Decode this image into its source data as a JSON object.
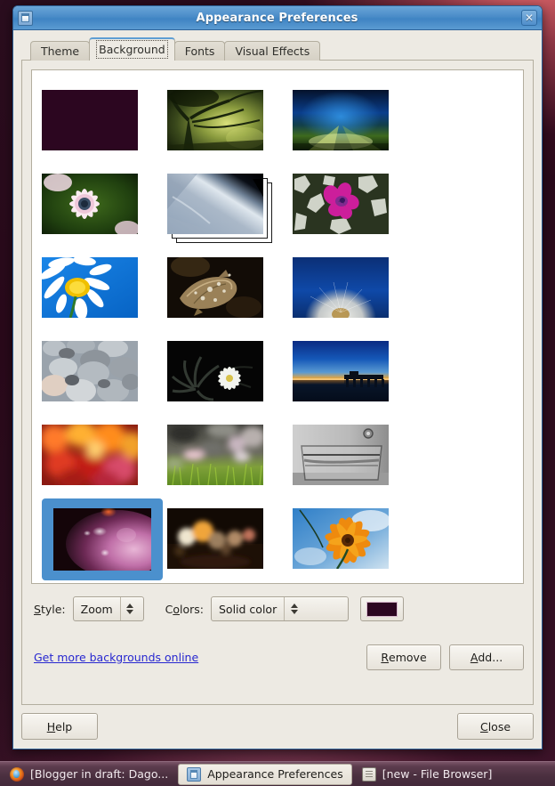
{
  "window": {
    "title": "Appearance Preferences",
    "icon": "appearance-window-icon",
    "close_icon": "close-icon",
    "titlebar_color": "#4a8cc8"
  },
  "tabs": [
    {
      "label": "Theme",
      "active": false
    },
    {
      "label": "Background",
      "active": true
    },
    {
      "label": "Fonts",
      "active": false
    },
    {
      "label": "Visual Effects",
      "active": false
    }
  ],
  "wallpapers": [
    {
      "name": "solid-plum",
      "type": "solid",
      "selected": false,
      "stacked": false
    },
    {
      "name": "backlit-tree",
      "type": "photo",
      "selected": false,
      "stacked": false
    },
    {
      "name": "blue-green-road-blur",
      "type": "photo",
      "selected": false,
      "stacked": false
    },
    {
      "name": "pink-white-daisy",
      "type": "photo",
      "selected": false,
      "stacked": false
    },
    {
      "name": "earth-from-orbit-slideshow",
      "type": "slideshow",
      "selected": false,
      "stacked": true
    },
    {
      "name": "magenta-flowers-silver-foliage",
      "type": "photo",
      "selected": false,
      "stacked": false
    },
    {
      "name": "white-daisy-blue-sky",
      "type": "photo",
      "selected": false,
      "stacked": false
    },
    {
      "name": "dry-leaf-dewdrops",
      "type": "photo",
      "selected": false,
      "stacked": false
    },
    {
      "name": "dandelion-seedhead-blue",
      "type": "photo",
      "selected": false,
      "stacked": false
    },
    {
      "name": "grey-pebbles",
      "type": "photo",
      "selected": false,
      "stacked": false
    },
    {
      "name": "white-flower-black-background",
      "type": "photo",
      "selected": false,
      "stacked": false
    },
    {
      "name": "pier-at-dusk",
      "type": "photo",
      "selected": false,
      "stacked": false
    },
    {
      "name": "red-orange-bokeh",
      "type": "photo",
      "selected": false,
      "stacked": false
    },
    {
      "name": "green-grass-bokeh",
      "type": "photo",
      "selected": false,
      "stacked": false
    },
    {
      "name": "greyscale-glass-water",
      "type": "photo",
      "selected": false,
      "stacked": false
    },
    {
      "name": "ubuntu-purple-warty",
      "type": "photo",
      "selected": true,
      "stacked": false
    },
    {
      "name": "amber-night-bokeh",
      "type": "photo",
      "selected": false,
      "stacked": false
    },
    {
      "name": "orange-cosmos-flower",
      "type": "photo",
      "selected": false,
      "stacked": false
    }
  ],
  "controls": {
    "style_label": "Style:",
    "style_label_mnemonic": "S",
    "style_value": "Zoom",
    "colors_label": "Colors:",
    "colors_label_mnemonic": "o",
    "colors_value": "Solid color",
    "color_swatch_hex": "#2c0620",
    "spinner_icon": "up-down-chevron-icon"
  },
  "links": {
    "more_backgrounds": "Get more backgrounds online"
  },
  "buttons": {
    "remove": "Remove",
    "remove_mnemonic": "R",
    "add": "Add...",
    "add_mnemonic": "A",
    "help": "Help",
    "help_mnemonic": "H",
    "close": "Close",
    "close_mnemonic": "C"
  },
  "taskbar": {
    "items": [
      {
        "label": "[Blogger in draft: Dago...",
        "icon": "firefox-icon",
        "active": false
      },
      {
        "label": "Appearance Preferences",
        "icon": "appearance-window-icon",
        "active": true
      },
      {
        "label": "[new - File Browser]",
        "icon": "file-browser-icon",
        "active": false
      }
    ]
  }
}
